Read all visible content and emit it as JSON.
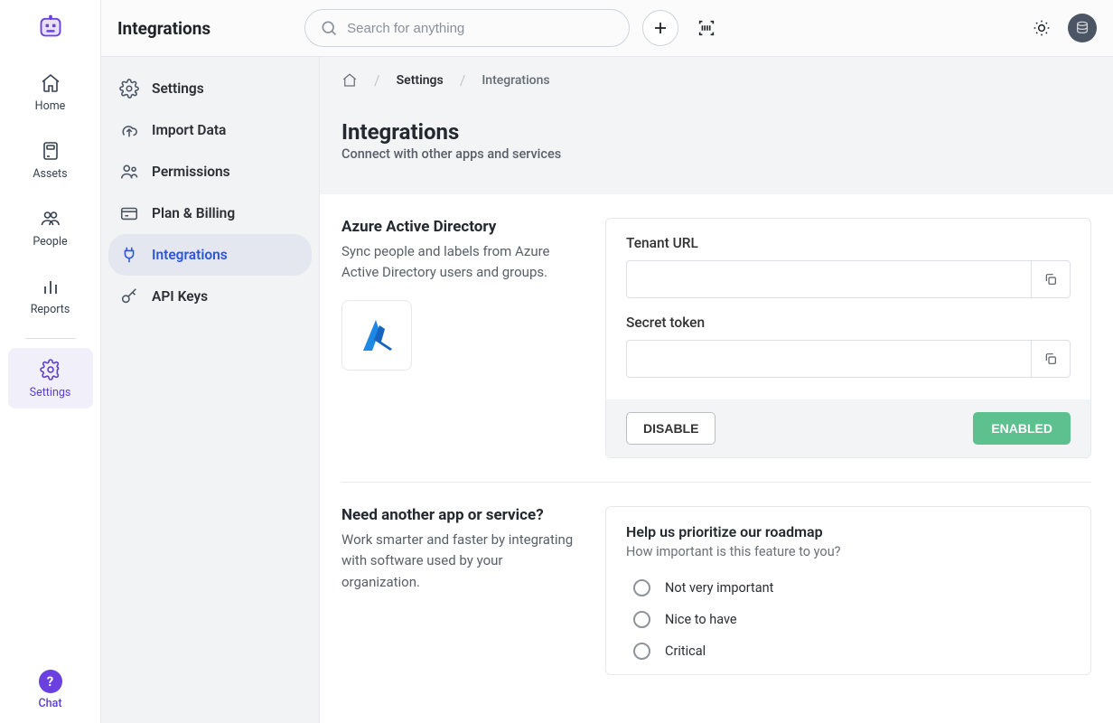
{
  "leftbar": {
    "items": [
      {
        "label": "Home"
      },
      {
        "label": "Assets"
      },
      {
        "label": "People"
      },
      {
        "label": "Reports"
      }
    ],
    "settings_label": "Settings",
    "chat_label": "Chat"
  },
  "header": {
    "title": "Integrations",
    "search_placeholder": "Search for anything"
  },
  "sub_sidebar": {
    "items": [
      {
        "label": "Settings"
      },
      {
        "label": "Import Data"
      },
      {
        "label": "Permissions"
      },
      {
        "label": "Plan & Billing"
      },
      {
        "label": "Integrations"
      },
      {
        "label": "API Keys"
      }
    ]
  },
  "breadcrumb": {
    "l1": "Settings",
    "l2": "Integrations"
  },
  "page": {
    "title": "Integrations",
    "subtitle": "Connect with other apps and services"
  },
  "azure": {
    "title": "Azure Active Directory",
    "desc": "Sync people and labels from Azure Active Directory users and groups.",
    "tenant_label": "Tenant URL",
    "tenant_value": "",
    "secret_label": "Secret token",
    "secret_value": "",
    "disable_label": "DISABLE",
    "enabled_label": "ENABLED"
  },
  "another": {
    "title": "Need another app or service?",
    "desc": "Work smarter and faster by integrating with software used by your organization."
  },
  "roadmap": {
    "title": "Help us prioritize our roadmap",
    "subtitle": "How important is this feature to you?",
    "options": [
      {
        "label": "Not very important"
      },
      {
        "label": "Nice to have"
      },
      {
        "label": "Critical"
      }
    ]
  }
}
